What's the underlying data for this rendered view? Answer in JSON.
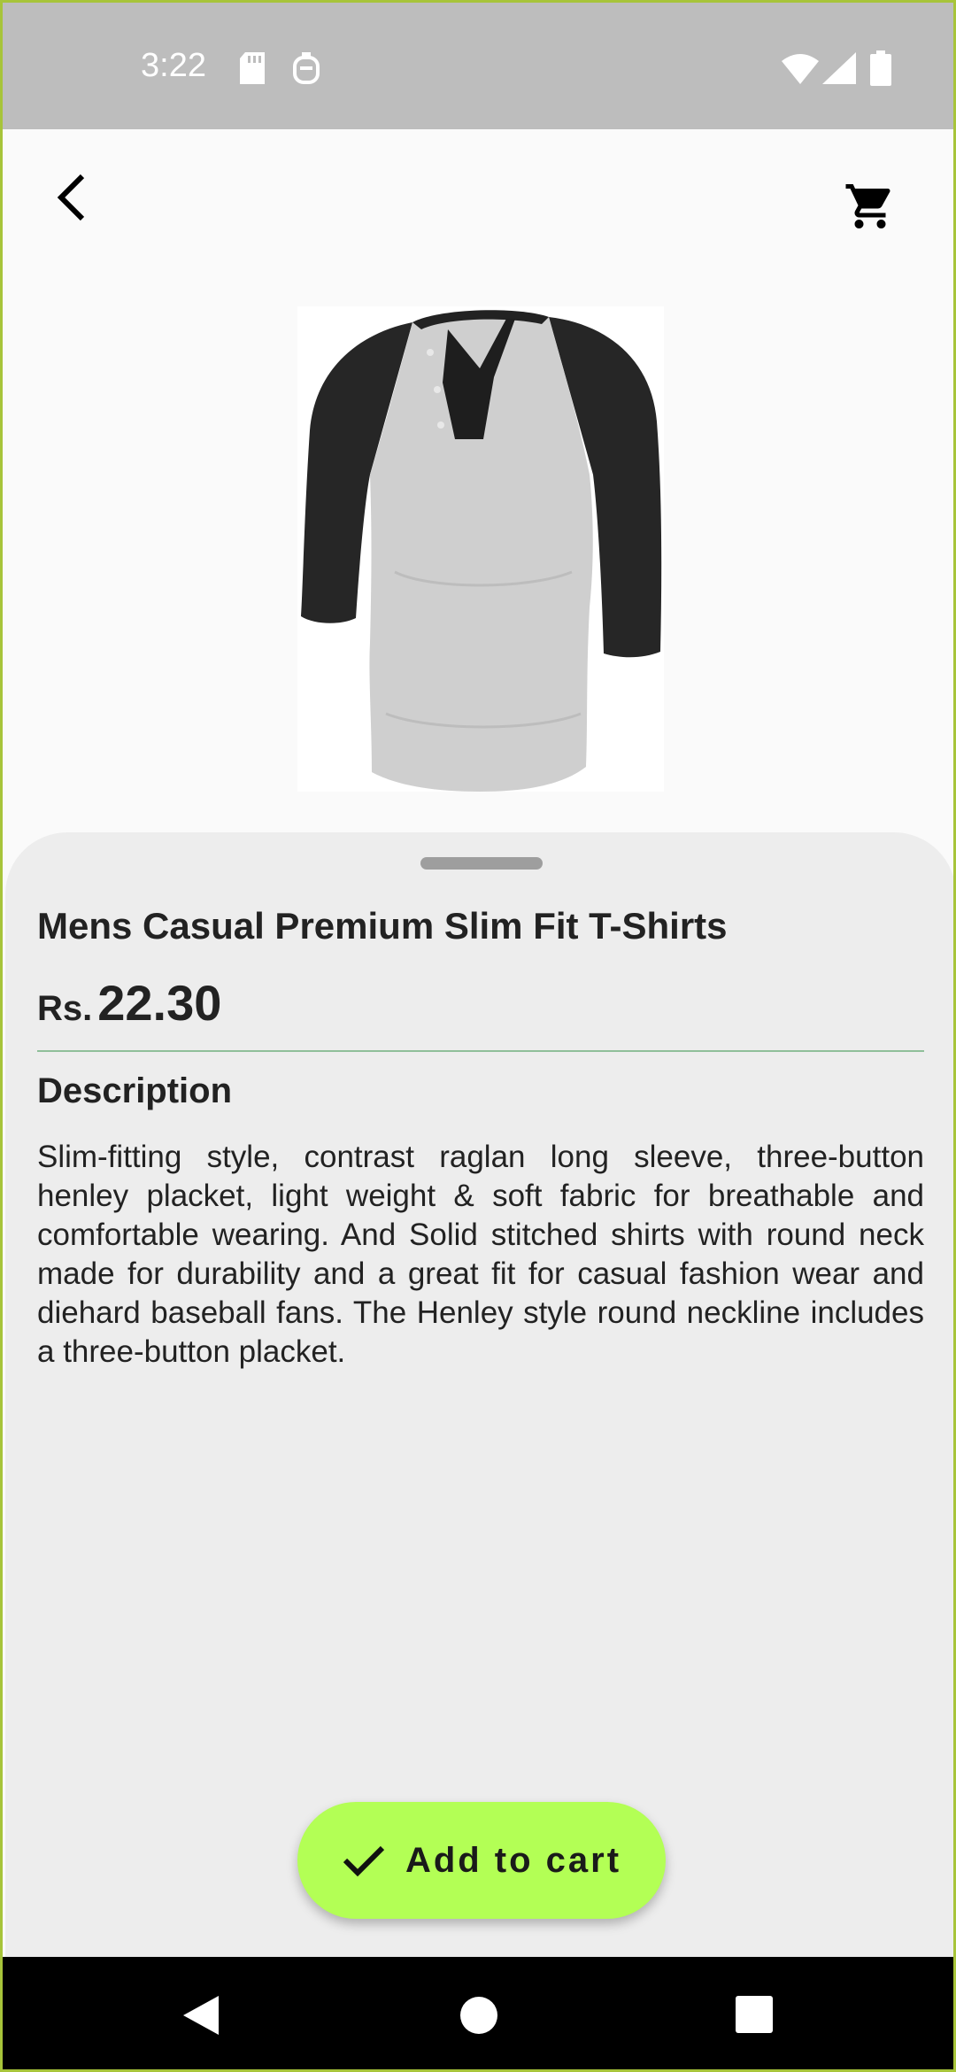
{
  "status_bar": {
    "time": "3:22",
    "icons": [
      "sd-card-icon",
      "notification-icon",
      "wifi-icon",
      "signal-icon",
      "battery-icon"
    ]
  },
  "app_bar": {
    "back_icon": "back-arrow-icon",
    "cart_icon": "shopping-cart-icon"
  },
  "product": {
    "image": "raglan-henley-shirt-image",
    "title": "Mens Casual Premium Slim Fit T-Shirts",
    "currency": "Rs.",
    "price": "22.30",
    "description_heading": "Description",
    "description": "Slim-fitting style, contrast raglan long sleeve, three-button henley placket, light weight & soft fabric for breathable and comfortable wearing. And Solid stitched shirts with round neck made for durability and a great fit for casual fashion wear and diehard baseball fans. The Henley style round neckline includes a three-button placket."
  },
  "actions": {
    "add_to_cart_label": "Add to cart",
    "add_to_cart_icon": "check-icon",
    "accent_color": "#b3ff55"
  },
  "nav_bar": {
    "icons": [
      "nav-back-icon",
      "nav-home-icon",
      "nav-recents-icon"
    ]
  }
}
